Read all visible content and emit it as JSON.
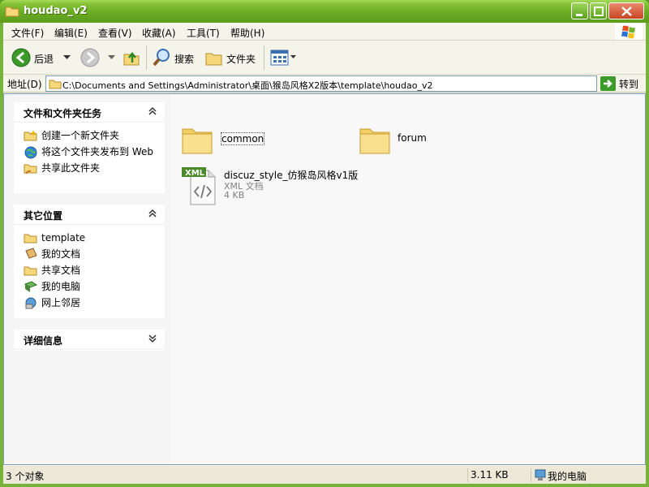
{
  "window": {
    "title": "houdao_v2"
  },
  "menu": [
    "文件(F)",
    "编辑(E)",
    "查看(V)",
    "收藏(A)",
    "工具(T)",
    "帮助(H)"
  ],
  "toolbar": {
    "back": "后退",
    "search": "搜索",
    "folders": "文件夹"
  },
  "address": {
    "label": "地址(D)",
    "path": "C:\\Documents and Settings\\Administrator\\桌面\\猴岛风格X2版本\\template\\houdao_v2",
    "go": "转到"
  },
  "taskpane": {
    "file_tasks": {
      "title": "文件和文件夹任务",
      "items": [
        "创建一个新文件夹",
        "将这个文件夹发布到 Web",
        "共享此文件夹"
      ]
    },
    "other_places": {
      "title": "其它位置",
      "items": [
        "template",
        "我的文档",
        "共享文档",
        "我的电脑",
        "网上邻居"
      ]
    },
    "details": {
      "title": "详细信息"
    }
  },
  "files": [
    {
      "name": "common",
      "type": "folder"
    },
    {
      "name": "forum",
      "type": "folder"
    },
    {
      "name": "discuz_style_仿猴岛风格v1版",
      "type": "XML 文档",
      "size": "4 KB",
      "badge": "XML"
    }
  ],
  "status": {
    "objects": "3 个对象",
    "size": "3.11 KB",
    "location": "我的电脑"
  },
  "colors": {
    "title_green": "#6aab23",
    "link_blue": "#0c2185"
  }
}
